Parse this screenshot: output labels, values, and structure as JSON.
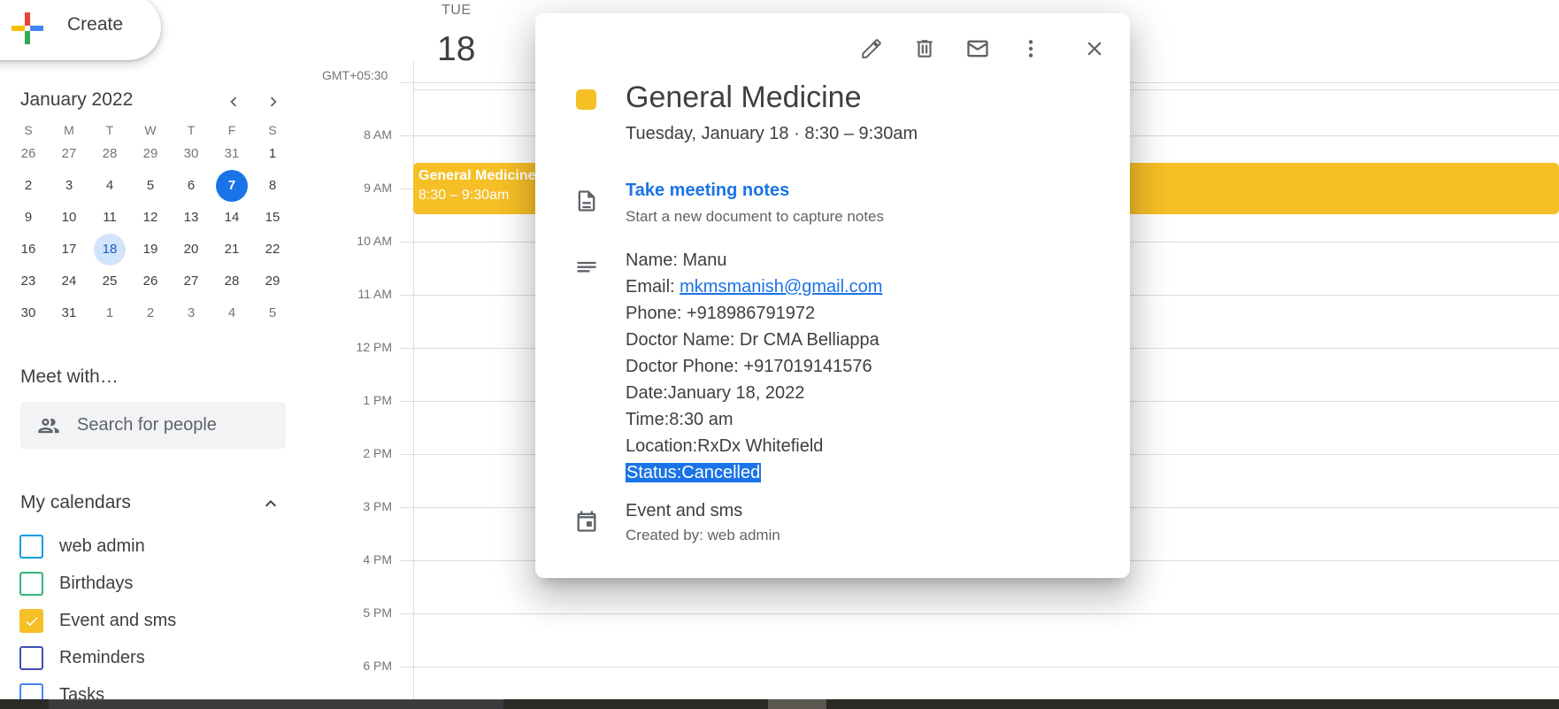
{
  "sidebar": {
    "create_label": "Create",
    "mini_calendar": {
      "month_label": "January 2022",
      "weekday_headers": [
        "S",
        "M",
        "T",
        "W",
        "T",
        "F",
        "S"
      ],
      "weeks": [
        [
          "26",
          "27",
          "28",
          "29",
          "30",
          "31",
          "1"
        ],
        [
          "2",
          "3",
          "4",
          "5",
          "6",
          "7",
          "8"
        ],
        [
          "9",
          "10",
          "11",
          "12",
          "13",
          "14",
          "15"
        ],
        [
          "16",
          "17",
          "18",
          "19",
          "20",
          "21",
          "22"
        ],
        [
          "23",
          "24",
          "25",
          "26",
          "27",
          "28",
          "29"
        ],
        [
          "30",
          "31",
          "1",
          "2",
          "3",
          "4",
          "5"
        ]
      ],
      "today": "7",
      "selected": "18"
    },
    "meet_with": {
      "title": "Meet with…",
      "search_placeholder": "Search for people"
    },
    "my_calendars": {
      "title": "My calendars",
      "items": [
        {
          "label": "web admin",
          "color": "#039be5",
          "checked": false
        },
        {
          "label": "Birthdays",
          "color": "#33b679",
          "checked": false
        },
        {
          "label": "Event and sms",
          "color": "#f6bf26",
          "checked": true
        },
        {
          "label": "Reminders",
          "color": "#3f51b5",
          "checked": false
        },
        {
          "label": "Tasks",
          "color": "#4285f4",
          "checked": false
        }
      ]
    }
  },
  "grid": {
    "timezone": "GMT+05:30",
    "day_name": "TUE",
    "day_number": "18",
    "hours": [
      "8 AM",
      "9 AM",
      "10 AM",
      "11 AM",
      "12 PM",
      "1 PM",
      "2 PM",
      "3 PM",
      "4 PM",
      "5 PM",
      "6 PM"
    ],
    "event": {
      "title": "General Medicine",
      "time": "8:30 – 9:30am",
      "color": "#f6bf26"
    }
  },
  "popup": {
    "title": "General Medicine",
    "when": "Tuesday, January 18  ·  8:30 – 9:30am",
    "color": "#f6bf26",
    "notes_link": "Take meeting notes",
    "notes_sub": "Start a new document to capture notes",
    "description": {
      "name": "Name: Manu",
      "email_label": "Email: ",
      "email": "mkmsmanish@gmail.com",
      "phone": "Phone: +918986791972",
      "doctor_name": "Doctor Name: Dr CMA Belliappa",
      "doctor_phone": "Doctor Phone: +917019141576",
      "date": "Date:January 18, 2022",
      "time": "Time:8:30 am",
      "location": "Location:RxDx Whitefield",
      "status": "Status:Cancelled"
    },
    "calendar_name": "Event and sms",
    "created_by": "Created by: web admin",
    "toolbar_icons": [
      "edit-icon",
      "delete-icon",
      "email-icon",
      "more-options-icon",
      "close-icon"
    ]
  }
}
